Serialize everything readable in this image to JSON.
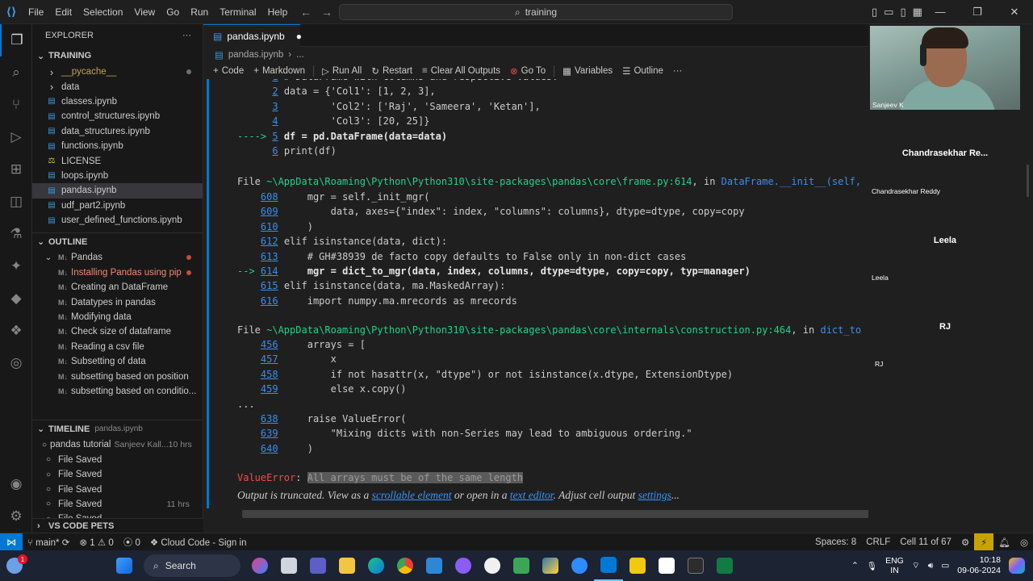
{
  "app": {
    "menu": [
      "File",
      "Edit",
      "Selection",
      "View",
      "Go",
      "Run",
      "Terminal",
      "Help"
    ],
    "search_text": "training",
    "nav_back": "←",
    "nav_forward": "→",
    "window_minimize": "—",
    "window_maximize": "❐",
    "window_close": "✕"
  },
  "sidebar": {
    "explorer_title": "EXPLORER",
    "folder": "TRAINING",
    "files": [
      {
        "name": "__pycache__",
        "type": "folder",
        "color": "#c5a15a"
      },
      {
        "name": "data",
        "type": "folder"
      },
      {
        "name": "classes.ipynb",
        "type": "notebook"
      },
      {
        "name": "control_structures.ipynb",
        "type": "notebook"
      },
      {
        "name": "data_structures.ipynb",
        "type": "notebook"
      },
      {
        "name": "functions.ipynb",
        "type": "notebook"
      },
      {
        "name": "LICENSE",
        "type": "license"
      },
      {
        "name": "loops.ipynb",
        "type": "notebook"
      },
      {
        "name": "pandas.ipynb",
        "type": "notebook",
        "selected": true
      },
      {
        "name": "udf_part2.ipynb",
        "type": "notebook"
      },
      {
        "name": "user_defined_functions.ipynb",
        "type": "notebook"
      }
    ],
    "outline_title": "OUTLINE",
    "outline_root": "Pandas",
    "outline_items": [
      {
        "label": "Installing Pandas using pip",
        "error": true
      },
      {
        "label": "Creating an DataFrame"
      },
      {
        "label": "Datatypes in pandas"
      },
      {
        "label": "Modifying data"
      },
      {
        "label": "Check size of dataframe"
      },
      {
        "label": "Reading a csv file"
      },
      {
        "label": "Subsetting of data"
      },
      {
        "label": "subsetting based on position"
      },
      {
        "label": "subsetting based on conditio..."
      }
    ],
    "timeline_title": "TIMELINE",
    "timeline_file": "pandas.ipynb",
    "timeline_items": [
      {
        "label": "pandas tutorial",
        "author": "Sanjeev Kall...",
        "time": "10 hrs"
      },
      {
        "label": "File Saved",
        "time": ""
      },
      {
        "label": "File Saved",
        "time": ""
      },
      {
        "label": "File Saved",
        "time": ""
      },
      {
        "label": "File Saved",
        "time": "11 hrs"
      },
      {
        "label": "File Saved",
        "time": ""
      }
    ],
    "pets_title": "VS CODE PETS"
  },
  "editor": {
    "tab_label": "pandas.ipynb",
    "breadcrumb": [
      "pandas.ipynb",
      "..."
    ],
    "toolbar": [
      "Code",
      "Markdown",
      "Run All",
      "Restart",
      "Clear All Outputs",
      "Go To",
      "Variables",
      "Outline",
      "···"
    ],
    "output_lines": [
      {
        "pre": "      ",
        "num": "1",
        "text": " # DataFrame with columns and respective values:"
      },
      {
        "pre": "      ",
        "num": "2",
        "text": " data = {'Col1': [1, 2, 3],"
      },
      {
        "pre": "      ",
        "num": "3",
        "text": "         'Col2': ['Raj', 'Sameera', 'Ketan'],"
      },
      {
        "pre": "      ",
        "num": "4",
        "text": "         'Col3': [20, 25]}"
      },
      {
        "pre": "----> ",
        "num": "5",
        "text": " df = pd.DataFrame(data=data)"
      },
      {
        "pre": "      ",
        "num": "6",
        "text": " print(df)"
      }
    ],
    "file1_prefix": "File ",
    "file1_path": "~\\AppData\\Roaming\\Python\\Python310\\site-packages\\pandas\\core\\frame.py:614",
    "file1_in": ", in ",
    "file1_func": "DataFrame.__init__(self,",
    "frame_lines": [
      {
        "pre": "    ",
        "num": "608",
        "text": "     mgr = self._init_mgr("
      },
      {
        "pre": "    ",
        "num": "609",
        "text": "         data, axes={\"index\": index, \"columns\": columns}, dtype=dtype, copy=copy"
      },
      {
        "pre": "    ",
        "num": "610",
        "text": "     )"
      },
      {
        "pre": "    ",
        "num": "612",
        "text": " elif isinstance(data, dict):"
      },
      {
        "pre": "    ",
        "num": "613",
        "text": "     # GH#38939 de facto copy defaults to False only in non-dict cases"
      },
      {
        "pre": "--> ",
        "num": "614",
        "text": "     mgr = dict_to_mgr(data, index, columns, dtype=dtype, copy=copy, typ=manager)"
      },
      {
        "pre": "    ",
        "num": "615",
        "text": " elif isinstance(data, ma.MaskedArray):"
      },
      {
        "pre": "    ",
        "num": "616",
        "text": "     import numpy.ma.mrecords as mrecords"
      }
    ],
    "file2_prefix": "File ",
    "file2_path": "~\\AppData\\Roaming\\Python\\Python310\\site-packages\\pandas\\core\\internals\\construction.py:464",
    "file2_in": ", in ",
    "file2_func": "dict_to",
    "construction_lines": [
      {
        "pre": "    ",
        "num": "456",
        "text": "     arrays = ["
      },
      {
        "pre": "    ",
        "num": "457",
        "text": "         x"
      },
      {
        "pre": "    ",
        "num": "458",
        "text": "         if not hasattr(x, \"dtype\") or not isinstance(x.dtype, ExtensionDtype)"
      },
      {
        "pre": "    ",
        "num": "459",
        "text": "         else x.copy()"
      }
    ],
    "ellipsis": "...",
    "raise_lines": [
      {
        "pre": "    ",
        "num": "638",
        "text": "     raise ValueError("
      },
      {
        "pre": "    ",
        "num": "639",
        "text": "         \"Mixing dicts with non-Series may lead to ambiguous ordering.\""
      },
      {
        "pre": "    ",
        "num": "640",
        "text": "     )"
      }
    ],
    "error_type": "ValueError",
    "error_colon": ": ",
    "error_message": "All arrays must be of the same length",
    "truncated_prefix": "Output is truncated. View as a ",
    "truncated_link1": "scrollable element",
    "truncated_mid": " or open in a ",
    "truncated_link2": "text editor",
    "truncated_mid2": ". Adjust cell output ",
    "truncated_link3": "settings",
    "truncated_suffix": "..."
  },
  "participants": {
    "self_name": "Sanjeev K",
    "people": [
      {
        "big": "Chandrasekhar Re...",
        "small": "Chandrasekhar Reddy"
      },
      {
        "big": "Leela",
        "small": "Leela"
      },
      {
        "big": "RJ",
        "small": "RJ"
      }
    ]
  },
  "statusbar": {
    "branch": "main*",
    "errors": "1",
    "warnings": "0",
    "ports": "0",
    "cloud": "Cloud Code - Sign in",
    "spaces": "Spaces: 8",
    "eol": "CRLF",
    "cell": "Cell 11 of 67"
  },
  "taskbar": {
    "search_label": "Search",
    "lang_top": "ENG",
    "lang_bottom": "IN",
    "time": "10:18",
    "date": "09-06-2024",
    "notification_count": "1"
  },
  "colors": {
    "accent": "#0078d4",
    "error": "#f14c4c",
    "link": "#3794ff",
    "path_green": "#23d18b"
  }
}
